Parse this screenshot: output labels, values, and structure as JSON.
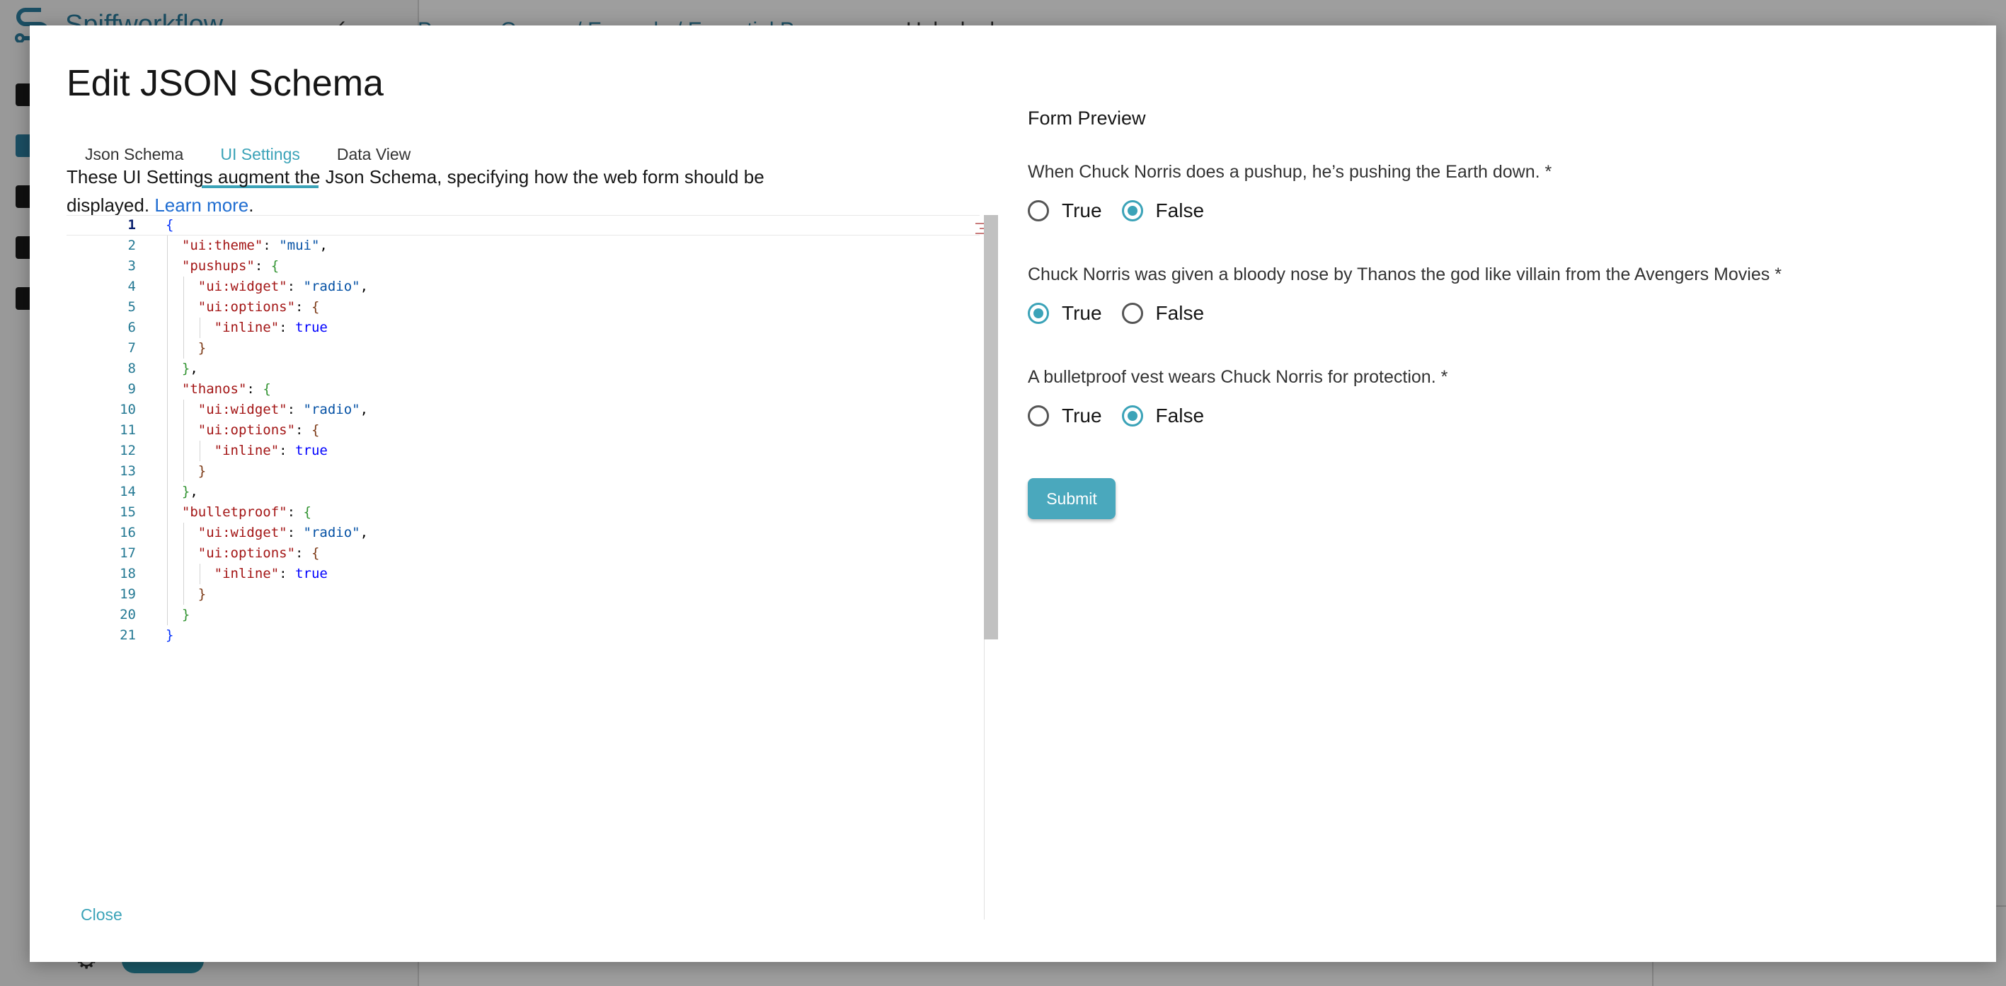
{
  "background_app": {
    "logo_text": "Spiffworkflow",
    "collapse_icon": "chevron-left",
    "breadcrumb": "Process Groups / Example / Essential Process",
    "breadcrumb_tail": "Unlocked"
  },
  "modal": {
    "title": "Edit JSON Schema",
    "tabs": [
      {
        "label": "Json Schema",
        "active": false
      },
      {
        "label": "UI Settings",
        "active": true
      },
      {
        "label": "Data View",
        "active": false
      }
    ],
    "description": "These UI Settings augment the Json Schema, specifying how the web form should be displayed.",
    "learn_more": "Learn more",
    "close_label": "Close"
  },
  "editor": {
    "current_line": 1,
    "lines": [
      "{",
      "  \"ui:theme\": \"mui\",",
      "  \"pushups\": {",
      "    \"ui:widget\": \"radio\",",
      "    \"ui:options\": {",
      "      \"inline\": true",
      "    }",
      "  },",
      "  \"thanos\": {",
      "    \"ui:widget\": \"radio\",",
      "    \"ui:options\": {",
      "      \"inline\": true",
      "    }",
      "  },",
      "  \"bulletproof\": {",
      "    \"ui:widget\": \"radio\",",
      "    \"ui:options\": {",
      "      \"inline\": true",
      "    }",
      "  }",
      "}"
    ]
  },
  "preview": {
    "title": "Form Preview",
    "questions": [
      {
        "label": "When Chuck Norris does a pushup, he’s pushing the Earth down.",
        "required": "*",
        "options": [
          "True",
          "False"
        ],
        "selected": "False"
      },
      {
        "label": "Chuck Norris was given a bloody nose by Thanos the god like villain from the Avengers Movies",
        "required": "*",
        "options": [
          "True",
          "False"
        ],
        "selected": "True"
      },
      {
        "label": "A bulletproof vest wears Chuck Norris for protection.",
        "required": "*",
        "options": [
          "True",
          "False"
        ],
        "selected": "False"
      }
    ],
    "submit_label": "Submit"
  },
  "colors": {
    "accent": "#3ba3b8",
    "link": "#1f6dd1",
    "submit_bg": "#4aa8bd"
  }
}
